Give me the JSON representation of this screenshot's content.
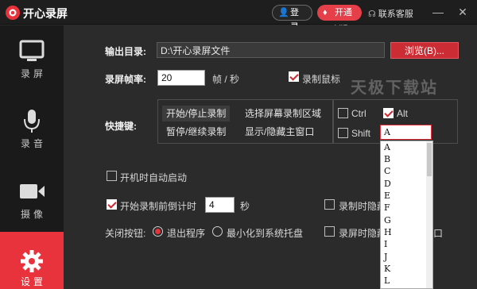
{
  "app": {
    "title": "开心录屏"
  },
  "titlebar": {
    "login_label": "登录",
    "vip_label": "开通VIP",
    "service_label": "联系客服"
  },
  "sidebar": {
    "items": [
      {
        "label": "录屏",
        "icon": "monitor-icon",
        "active": false
      },
      {
        "label": "录音",
        "icon": "microphone-icon",
        "active": false
      },
      {
        "label": "摄像",
        "icon": "camera-icon",
        "active": false
      },
      {
        "label": "设置",
        "icon": "gear-icon",
        "active": true
      }
    ]
  },
  "settings": {
    "output_dir_label": "输出目录:",
    "output_dir_value": "D:\\开心录屏文件",
    "browse_label": "浏览(B)...",
    "fps_label": "录屏帧率:",
    "fps_value": "20",
    "fps_unit": "帧 / 秒",
    "record_cursor_label": "录制鼠标",
    "record_cursor_checked": true,
    "hotkey_label": "快捷键:",
    "hotkey_actions": [
      "开始/停止录制",
      "选择屏幕录制区域",
      "暂停/继续录制",
      "显示/隐藏主窗口"
    ],
    "modifiers": {
      "ctrl": "Ctrl",
      "alt": "Alt",
      "shift": "Shift",
      "ctrl_checked": false,
      "alt_checked": true,
      "shift_checked": false
    },
    "key_value": "A",
    "key_options": [
      "A",
      "B",
      "C",
      "D",
      "E",
      "F",
      "G",
      "H",
      "I",
      "J",
      "K",
      "L"
    ],
    "autostart_label": "开机时自动启动",
    "autostart_checked": false,
    "countdown_label": "开始录制前倒计时",
    "countdown_checked": true,
    "countdown_value": "4",
    "countdown_unit": "秒",
    "hide_on_record_label_1": "录制时隐藏",
    "hide_on_record_label_2": "录屏时隐藏",
    "close_button_label": "关闭按钮:",
    "close_options": [
      "退出程序",
      "最小化到系统托盘"
    ],
    "close_selected": 0,
    "partial_suffix": "口"
  },
  "watermark": "天极下载站",
  "colors": {
    "accent": "#e8323c",
    "background": "#2b2b2b",
    "sidebar": "#1a1a1a"
  }
}
